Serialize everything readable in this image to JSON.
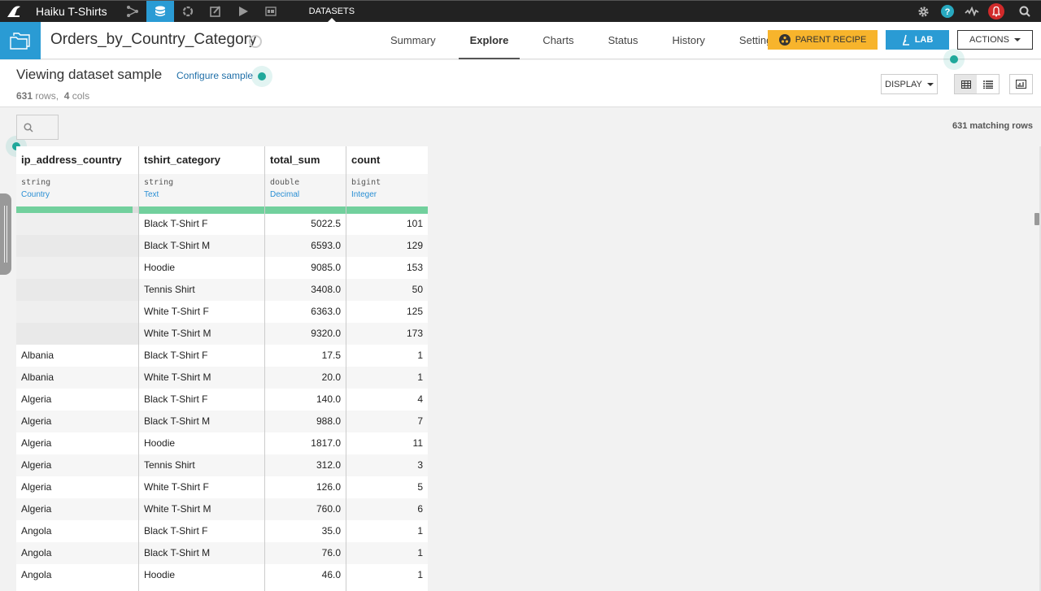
{
  "topnav": {
    "project_name": "Haiku T-Shirts",
    "icons": [
      "flow-icon",
      "datasets-icon",
      "recipes-icon",
      "notebooks-icon",
      "jobs-icon",
      "dashboards-icon"
    ],
    "active_icon": "datasets-icon",
    "section_label": "DATASETS",
    "right_icons": [
      "gear-icon",
      "help-icon",
      "activity-icon",
      "notifications-bell-icon",
      "search-icon"
    ]
  },
  "dataset": {
    "name": "Orders_by_Country_Category",
    "tabs": [
      {
        "label": "Summary",
        "active": false
      },
      {
        "label": "Explore",
        "active": true
      },
      {
        "label": "Charts",
        "active": false
      },
      {
        "label": "Status",
        "active": false
      },
      {
        "label": "History",
        "active": false
      },
      {
        "label": "Settings",
        "active": false
      }
    ],
    "parent_recipe_label": "PARENT RECIPE",
    "lab_label": "LAB",
    "actions_label": "ACTIONS"
  },
  "sample": {
    "title": "Viewing dataset sample",
    "configure_label": "Configure sample",
    "rows_count": "631",
    "rows_label": "rows,",
    "cols_count": "4",
    "cols_label": "cols",
    "display_label": "DISPLAY",
    "matching_rows": "631 matching rows"
  },
  "colors": {
    "accent_blue": "#2a9bd4",
    "parent_recipe_yellow": "#f7b42c",
    "quality_green": "#72d09d",
    "hint_teal": "#1fa89b",
    "topbar": "#222222"
  },
  "table": {
    "columns": [
      {
        "name": "ip_address_country",
        "type": "string",
        "meaning": "Country"
      },
      {
        "name": "tshirt_category",
        "type": "string",
        "meaning": "Text"
      },
      {
        "name": "total_sum",
        "type": "double",
        "meaning": "Decimal"
      },
      {
        "name": "count",
        "type": "bigint",
        "meaning": "Integer"
      }
    ],
    "rows": [
      [
        "",
        "Black T-Shirt F",
        "5022.5",
        "101"
      ],
      [
        "",
        "Black T-Shirt M",
        "6593.0",
        "129"
      ],
      [
        "",
        "Hoodie",
        "9085.0",
        "153"
      ],
      [
        "",
        "Tennis Shirt",
        "3408.0",
        "50"
      ],
      [
        "",
        "White T-Shirt F",
        "6363.0",
        "125"
      ],
      [
        "",
        "White T-Shirt M",
        "9320.0",
        "173"
      ],
      [
        "Albania",
        "Black T-Shirt F",
        "17.5",
        "1"
      ],
      [
        "Albania",
        "White T-Shirt M",
        "20.0",
        "1"
      ],
      [
        "Algeria",
        "Black T-Shirt F",
        "140.0",
        "4"
      ],
      [
        "Algeria",
        "Black T-Shirt M",
        "988.0",
        "7"
      ],
      [
        "Algeria",
        "Hoodie",
        "1817.0",
        "11"
      ],
      [
        "Algeria",
        "Tennis Shirt",
        "312.0",
        "3"
      ],
      [
        "Algeria",
        "White T-Shirt F",
        "126.0",
        "5"
      ],
      [
        "Algeria",
        "White T-Shirt M",
        "760.0",
        "6"
      ],
      [
        "Angola",
        "Black T-Shirt F",
        "35.0",
        "1"
      ],
      [
        "Angola",
        "Black T-Shirt M",
        "76.0",
        "1"
      ],
      [
        "Angola",
        "Hoodie",
        "46.0",
        "1"
      ]
    ]
  }
}
